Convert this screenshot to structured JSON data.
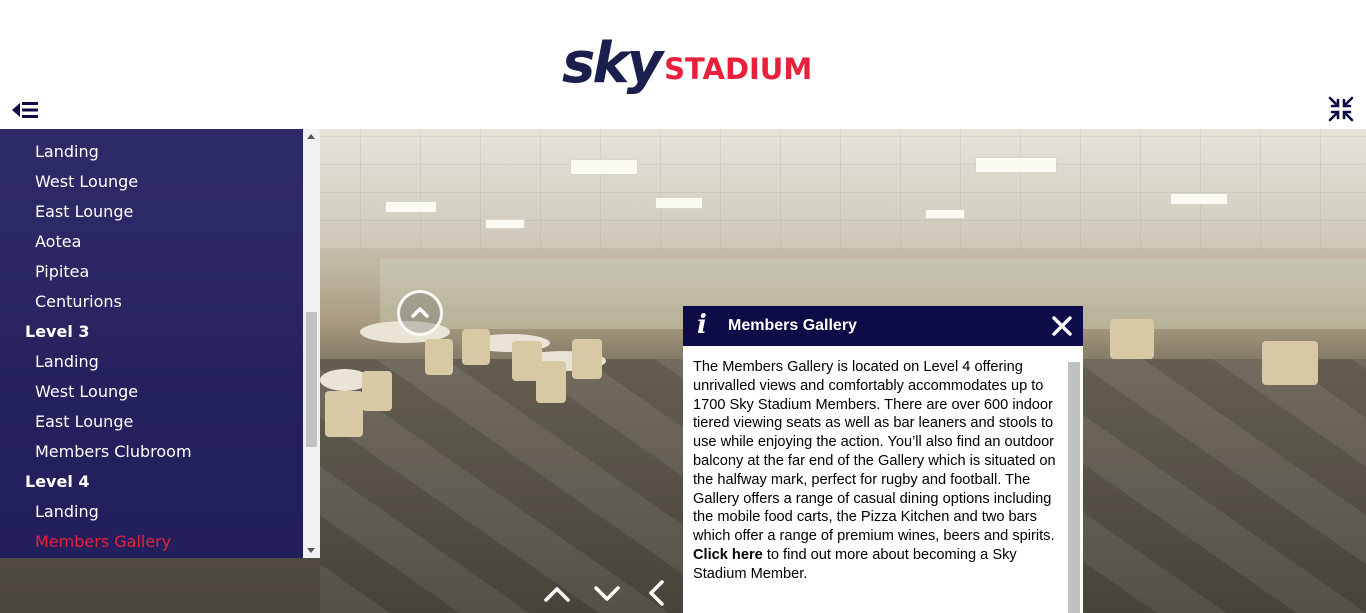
{
  "header": {
    "logo_sky": "sky",
    "logo_stadium": "STADIUM",
    "brand_navy": "#1a1f4e",
    "brand_red": "#e8203a",
    "menu_toggle_icon": "menu-collapse-icon",
    "fullscreen_icon": "fullscreen-exit-icon"
  },
  "sidebar": {
    "items": [
      {
        "label": "Landing",
        "type": "item"
      },
      {
        "label": "West Lounge",
        "type": "item"
      },
      {
        "label": "East Lounge",
        "type": "item"
      },
      {
        "label": "Aotea",
        "type": "item"
      },
      {
        "label": "Pipitea",
        "type": "item"
      },
      {
        "label": "Centurions",
        "type": "item"
      },
      {
        "label": "Level 3",
        "type": "level"
      },
      {
        "label": "Landing",
        "type": "item"
      },
      {
        "label": "West Lounge",
        "type": "item"
      },
      {
        "label": "East Lounge",
        "type": "item"
      },
      {
        "label": "Members Clubroom",
        "type": "item"
      },
      {
        "label": "Level 4",
        "type": "level"
      },
      {
        "label": "Landing",
        "type": "item"
      },
      {
        "label": "Members Gallery",
        "type": "item",
        "active": true
      }
    ]
  },
  "viewer": {
    "hotspot_icon": "chevron-up-circle-icon",
    "nav": [
      "up-arrow-icon",
      "down-arrow-icon",
      "left-arrow-icon"
    ]
  },
  "info_panel": {
    "icon": "i",
    "title": "Members Gallery",
    "body": "The Members Gallery is located on Level 4 offering unrivalled views and comfortably accommodates up to 1700 Sky Stadium Members. There are over 600 indoor tiered viewing seats as well as bar leaners and stools to use while enjoying the action. You’ll also find an outdoor balcony at the far end of the Gallery which is situated on the halfway mark, perfect for rugby and football. The Gallery offers a range of casual dining options including the mobile food carts, the Pizza Kitchen and two bars which offer a range of premium wines, beers and spirits.",
    "link_text": "Click here",
    "link_suffix": " to find out more about becoming a Sky Stadium Member."
  }
}
